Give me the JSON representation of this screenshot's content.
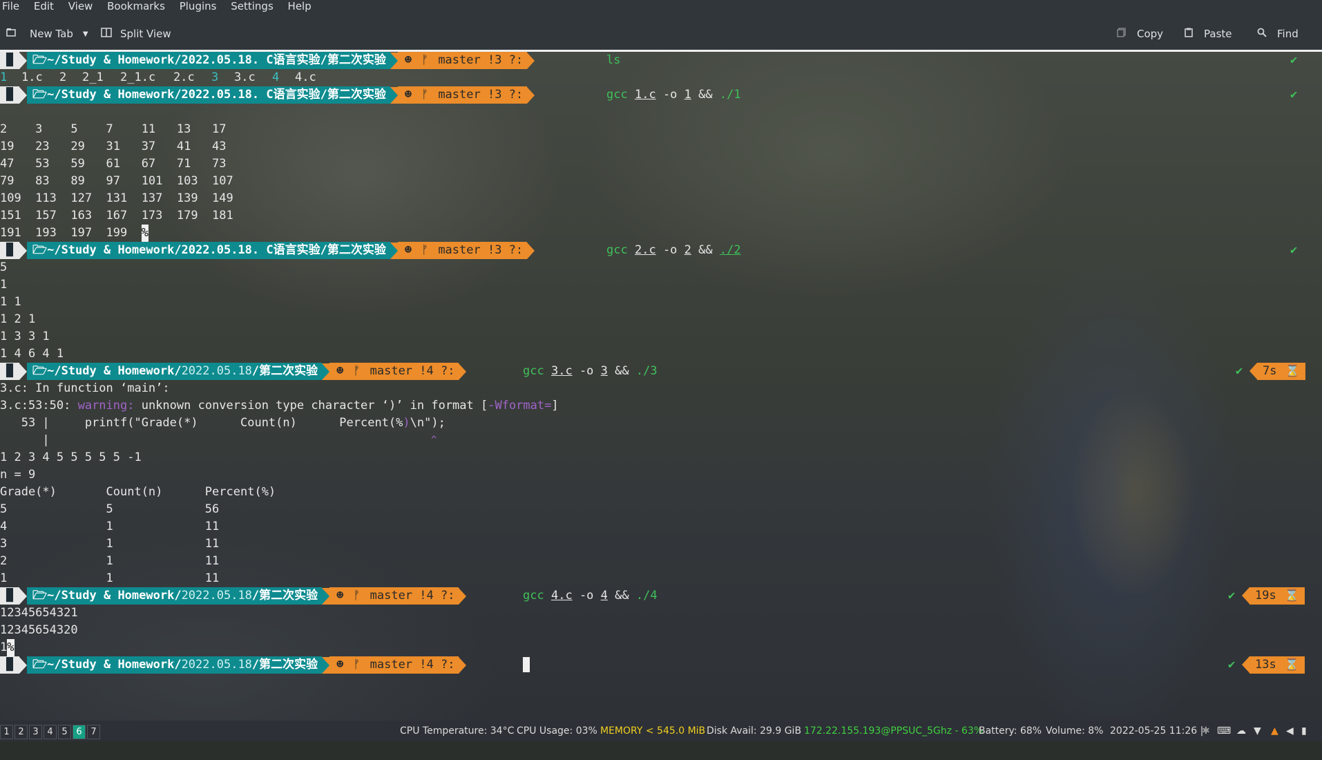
{
  "menu": [
    "File",
    "Edit",
    "View",
    "Bookmarks",
    "Plugins",
    "Settings",
    "Help"
  ],
  "toolbar": {
    "new_tab": "New Tab",
    "split_view": "Split View",
    "copy": "Copy",
    "paste": "Paste",
    "find": "Find"
  },
  "prompts": {
    "path_a": "~/Study & Homework/2022.05.18. C语言实验/第二次实验",
    "path_b_1": "~/Study & Homework/",
    "path_b_2": "2022.05.18",
    "path_b_3": "/第二次实验",
    "git_a": "master !3 ?:",
    "git_b": "master !4 ?:"
  },
  "commands": {
    "c1": "ls",
    "c2_gcc": "gcc",
    "c2_src": "1.c",
    "c2_o": "-o",
    "c2_out": "1",
    "c2_and": "&&",
    "c2_run": "./1",
    "c3_gcc": "gcc",
    "c3_src": "2.c",
    "c3_o": "-o",
    "c3_out": "2",
    "c3_and": "&&",
    "c3_run": "./2",
    "c4_gcc": "gcc",
    "c4_src": "3.c",
    "c4_o": "-o",
    "c4_out": "3",
    "c4_and": "&&",
    "c4_run": "./3",
    "c5_gcc": "gcc",
    "c5_src": "4.c",
    "c5_o": "-o",
    "c5_out": "4",
    "c5_and": "&&",
    "c5_run": "./4"
  },
  "ls_output": {
    "f1": "1",
    "f2": "1.c",
    "f3": "2",
    "f4": "2_1",
    "f5": "2_1.c",
    "f6": "2.c",
    "f7": "3",
    "f8": "3.c",
    "f9": "4",
    "f10": "4.c"
  },
  "primes_output": [
    "2    3    5    7    11   13   17",
    "19   23   29   31   37   41   43",
    "47   53   59   61   67   71   73",
    "79   83   89   97   101  103  107",
    "109  113  127  131  137  139  149",
    "151  157  163  167  173  179  181",
    "191  193  197  199  "
  ],
  "pct_mark": "%",
  "pascal_output": [
    "5",
    "1",
    "1 1",
    "1 2 1",
    "1 3 3 1",
    "1 4 6 4 1"
  ],
  "warning": {
    "line1": "3.c: In function ‘main’:",
    "loc": "3.c:53:50: ",
    "label": "warning:",
    "msg": " unknown conversion type character ‘)’ in format [",
    "flag": "-Wformat=",
    "close": "]",
    "src_pre": "   53 |     printf(\"Grade(*)      Count(n)      Percent(%",
    "src_hl": ")",
    "src_post": "\\n\");",
    "bar": "      |",
    "caret": "^"
  },
  "grade_output": [
    "1 2 3 4 5 5 5 5 5 -1",
    "n = 9",
    "Grade(*)       Count(n)      Percent(%)",
    "5              5             56",
    "4              1             11",
    "3              1             11",
    "2              1             11",
    "1              1             11"
  ],
  "palindrome_output": [
    "12345654321",
    "12345654320",
    "1"
  ],
  "durations": {
    "d1": "7s",
    "d2": "19s",
    "d3": "13s"
  },
  "checkmark": "✔",
  "status": {
    "workspaces": [
      "1",
      "2",
      "3",
      "4",
      "5",
      "6",
      "7"
    ],
    "active_workspace": "6",
    "cpu_temp": "CPU Temperature: 34°C",
    "cpu_usage": "CPU Usage: 03%",
    "memory": "MEMORY < 545.0 MiB",
    "disk": "Disk Avail: 29.9 GiB",
    "network": "172.22.155.193@PPSUC_5Ghz -  63%",
    "battery": "Battery:  68%",
    "volume": "Volume: 8%",
    "datetime": "2022-05-25 11:26 |"
  },
  "colors": {
    "accent_teal": "#0e8b8f",
    "accent_orange": "#ec8c2a",
    "ok_green": "#3fc05a",
    "warn_purple": "#a064c8",
    "memory_yellow": "#f0d020",
    "network_green": "#40d040"
  }
}
